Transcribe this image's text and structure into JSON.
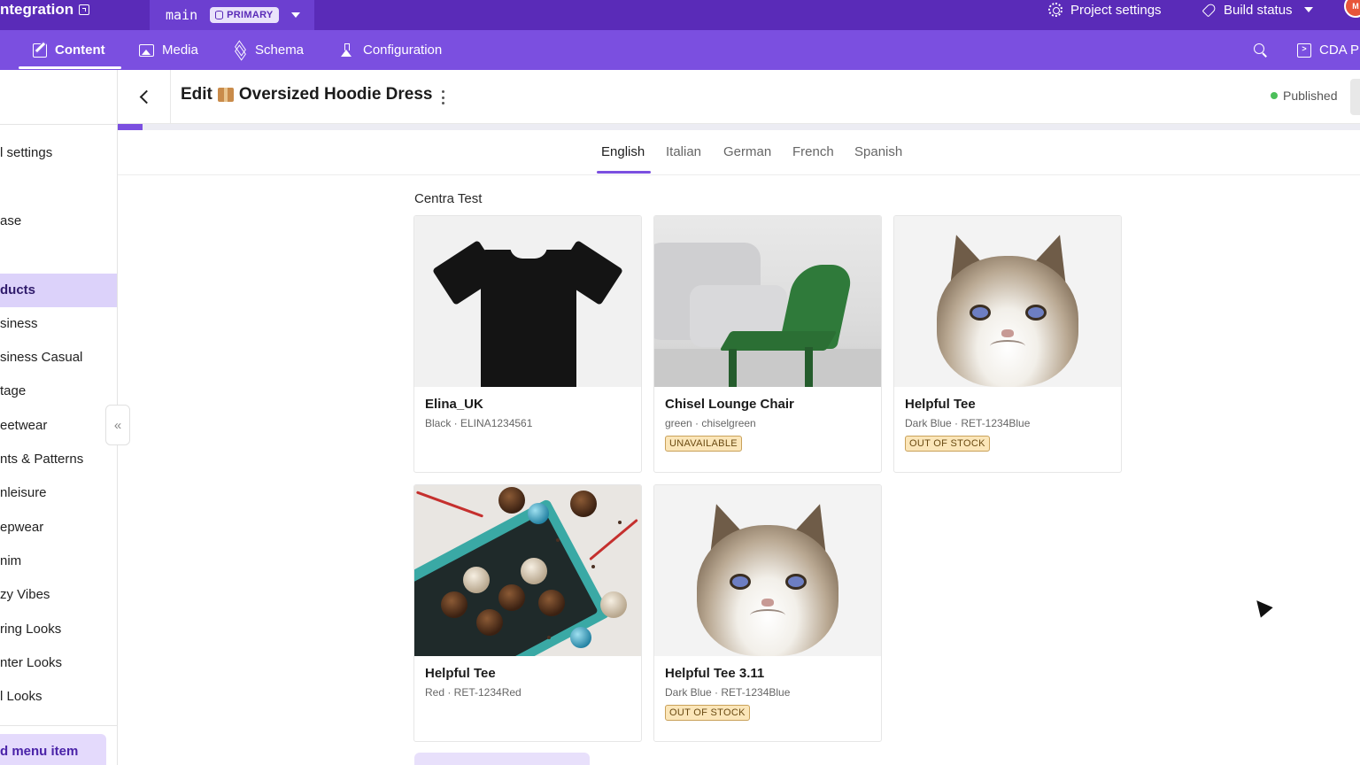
{
  "topbar": {
    "brand": "ntegration",
    "branch": "main",
    "branch_badge": "PRIMARY",
    "project_settings": "Project settings",
    "build_status": "Build status",
    "avatar_initial": "M"
  },
  "nav": {
    "content": "Content",
    "media": "Media",
    "schema": "Schema",
    "configuration": "Configuration",
    "cda": "CDA P"
  },
  "sidebar": {
    "items": [
      {
        "label": "l settings"
      },
      {
        "label": "ase"
      },
      {
        "label": "ducts"
      },
      {
        "label": "siness"
      },
      {
        "label": "siness Casual"
      },
      {
        "label": "tage"
      },
      {
        "label": "eetwear"
      },
      {
        "label": "nts & Patterns"
      },
      {
        "label": "nleisure"
      },
      {
        "label": "epwear"
      },
      {
        "label": "nim"
      },
      {
        "label": "zy Vibes"
      },
      {
        "label": "ring Looks"
      },
      {
        "label": "nter Looks"
      },
      {
        "label": "l Looks"
      }
    ],
    "add_menu_item": "d menu item"
  },
  "header": {
    "edit_prefix": "Edit",
    "record_title": "Oversized Hoodie Dress",
    "status": "Published",
    "status_color": "#4cbf5a"
  },
  "locale_tabs": [
    {
      "label": "English",
      "active": true
    },
    {
      "label": "Italian"
    },
    {
      "label": "German"
    },
    {
      "label": "French"
    },
    {
      "label": "Spanish"
    }
  ],
  "section_label": "Centra Test",
  "products": [
    {
      "title": "Elina_UK",
      "subtitle": "Black · ELINA1234561",
      "badge": "",
      "image": "black-tshirt"
    },
    {
      "title": "Chisel Lounge Chair",
      "subtitle": "green · chiselgreen",
      "badge": "UNAVAILABLE",
      "image": "green-chair"
    },
    {
      "title": "Helpful Tee",
      "subtitle": "Dark Blue · RET-1234Blue",
      "badge": "OUT OF STOCK",
      "image": "grumpy-cat"
    },
    {
      "title": "Helpful Tee",
      "subtitle": "Red · RET-1234Red",
      "badge": "",
      "image": "chocolates"
    },
    {
      "title": "Helpful Tee 3.11",
      "subtitle": "Dark Blue · RET-1234Blue",
      "badge": "OUT OF STOCK",
      "image": "grumpy-cat"
    }
  ],
  "colors": {
    "topbar": "#5a2bb8",
    "navbar": "#7b4fe0",
    "accent": "#7b4fe0",
    "badge_bg": "#fbe6b9"
  }
}
